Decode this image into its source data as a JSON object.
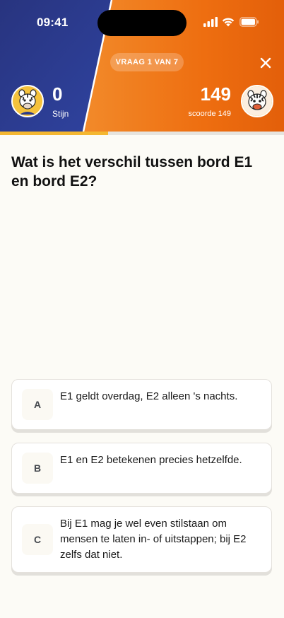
{
  "status_bar": {
    "time": "09:41",
    "icons": [
      "cellular-signal-icon",
      "wifi-icon",
      "battery-icon"
    ]
  },
  "header": {
    "question_counter": "VRAAG 1 VAN 7",
    "close_icon": "close-icon",
    "player": {
      "name": "Stijn",
      "score": "0",
      "avatar": "zebra-avatar-icon"
    },
    "opponent": {
      "score": "149",
      "label": "scoorde 149",
      "avatar": "zebra-avatar-icon"
    },
    "colors": {
      "left": "#2b3a8c",
      "right": "#f27a1a",
      "divider": "#ffffff"
    }
  },
  "progress": {
    "fraction": 0.38,
    "color": "#f4b731"
  },
  "question": {
    "text": "Wat is het verschil tussen bord E1 en bord E2?"
  },
  "answers": [
    {
      "letter": "A",
      "text": "E1 geldt overdag, E2 alleen 's nachts."
    },
    {
      "letter": "B",
      "text": "E1 en E2 betekenen precies hetzelfde."
    },
    {
      "letter": "C",
      "text": "Bij E1 mag je wel even stilstaan om mensen te laten in- of uitstappen; bij E2 zelfs dat niet."
    }
  ]
}
